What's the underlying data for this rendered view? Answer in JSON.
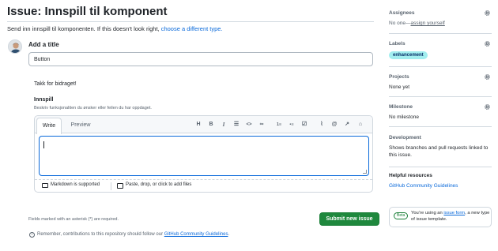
{
  "header": {
    "title": "Issue: Innspill til komponent",
    "subtitle_prefix": "Send inn innspill til komponenten. If this doesn’t look right,",
    "subtitle_link": "choose a different type."
  },
  "form": {
    "add_title_label": "Add a title",
    "title_value": "Button",
    "thanks_text": "Takk for bidraget!",
    "field_label": "Innspill",
    "field_description": "Beskriv funksjonaliten du ønsker eller feilen du har oppdaget.",
    "editor": {
      "tabs": [
        "Write",
        "Preview"
      ],
      "toolbar_icons": [
        "heading-icon",
        "bold-icon",
        "italic-icon",
        "quote-icon",
        "code-icon",
        "link-icon",
        "numbered-list-icon",
        "bulleted-list-icon",
        "task-list-icon",
        "attach-icon",
        "mention-icon",
        "reference-icon",
        "saved-reply-icon"
      ],
      "toolbar_glyphs": [
        "H",
        "B",
        "I",
        "☰",
        "<>",
        "∞",
        "1≡",
        "•≡",
        "☑",
        "⌇",
        "@",
        "↗",
        "⌂"
      ],
      "markdown_label": "Markdown is supported",
      "paste_label": "Paste, drop, or click to add files"
    },
    "required_note": "Fields marked with an asterisk (*) are required.",
    "submit_label": "Submit new issue",
    "remember_prefix": "Remember, contributions to this repository should follow our",
    "remember_link": "GitHub Community Guidelines",
    "remember_suffix": "."
  },
  "sidebar": {
    "assignees": {
      "heading": "Assignees",
      "value_prefix": "No one—",
      "value_link": "assign yourself"
    },
    "labels": {
      "heading": "Labels",
      "label": "enhancement",
      "label_color": "#a2eeef"
    },
    "projects": {
      "heading": "Projects",
      "value": "None yet"
    },
    "milestone": {
      "heading": "Milestone",
      "value": "No milestone"
    },
    "development": {
      "heading": "Development",
      "value": "Shows branches and pull requests linked to this issue."
    },
    "helpful": {
      "heading": "Helpful resources",
      "link": "GitHub Community Guidelines"
    },
    "card": {
      "badge": "Beta",
      "text_prefix": "You’re using an",
      "text_link": "issue form",
      "text_suffix": ", a new type of issue template."
    }
  },
  "colors": {
    "accent": "#0969da",
    "submit": "#1f883d",
    "muted": "#59636e"
  }
}
